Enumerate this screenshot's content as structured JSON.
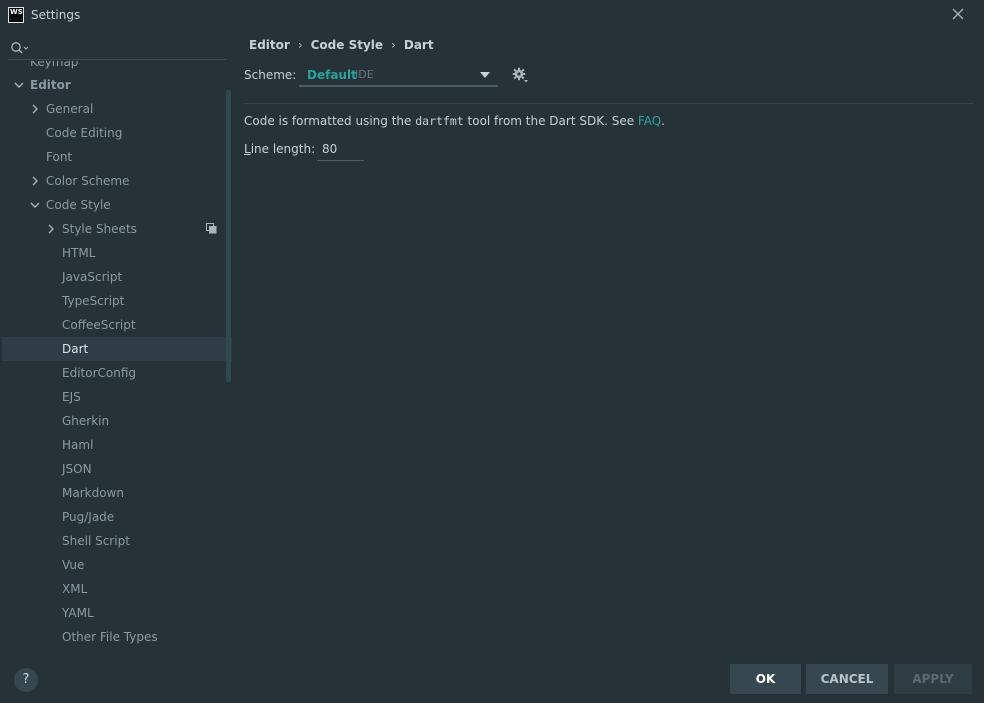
{
  "window": {
    "logo": "WS",
    "title": "Settings"
  },
  "search": {
    "value": "",
    "placeholder": ""
  },
  "tree": {
    "partial_item": "Keymap",
    "items": [
      {
        "label": "Editor",
        "level": 0,
        "expanded": true
      },
      {
        "label": "General",
        "level": 1,
        "collapsed": true
      },
      {
        "label": "Code Editing",
        "level": 1
      },
      {
        "label": "Font",
        "level": 1
      },
      {
        "label": "Color Scheme",
        "level": 1,
        "collapsed": true
      },
      {
        "label": "Code Style",
        "level": 1,
        "expanded": true
      },
      {
        "label": "Style Sheets",
        "level": 2,
        "collapsed": true
      },
      {
        "label": "HTML",
        "level": 2
      },
      {
        "label": "JavaScript",
        "level": 2
      },
      {
        "label": "TypeScript",
        "level": 2
      },
      {
        "label": "CoffeeScript",
        "level": 2
      },
      {
        "label": "Dart",
        "level": 2,
        "selected": true
      },
      {
        "label": "EditorConfig",
        "level": 2
      },
      {
        "label": "EJS",
        "level": 2
      },
      {
        "label": "Gherkin",
        "level": 2
      },
      {
        "label": "Haml",
        "level": 2
      },
      {
        "label": "JSON",
        "level": 2
      },
      {
        "label": "Markdown",
        "level": 2
      },
      {
        "label": "Pug/Jade",
        "level": 2
      },
      {
        "label": "Shell Script",
        "level": 2
      },
      {
        "label": "Vue",
        "level": 2
      },
      {
        "label": "XML",
        "level": 2
      },
      {
        "label": "YAML",
        "level": 2
      },
      {
        "label": "Other File Types",
        "level": 2
      }
    ]
  },
  "help": {
    "label": "?"
  },
  "breadcrumb": [
    "Editor",
    "Code Style",
    "Dart"
  ],
  "scheme": {
    "label": "Scheme:",
    "value": "Default",
    "level": "IDE"
  },
  "description": {
    "prefix": "Code is formatted using the ",
    "tool": "dartfmt",
    "suffix": " tool from the Dart SDK. See ",
    "link": "FAQ",
    "end": "."
  },
  "line_length": {
    "label_mnemonic": "L",
    "label_rest": "ine length:",
    "value": "80"
  },
  "buttons": {
    "ok": "OK",
    "cancel": "CANCEL",
    "apply": "APPLY"
  },
  "colors": {
    "background": "#263238",
    "accent": "#26a69a",
    "selection": "#2f3e46"
  }
}
